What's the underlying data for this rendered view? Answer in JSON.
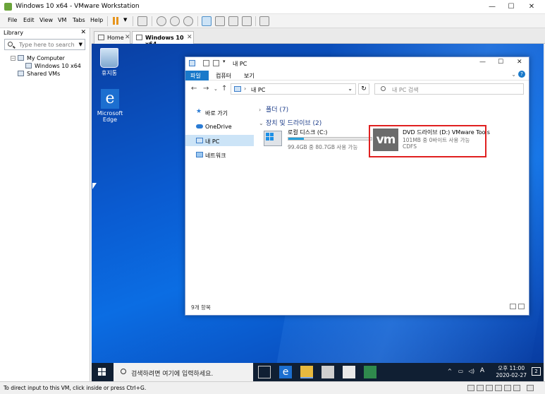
{
  "window": {
    "title": "Windows 10 x64 - VMware Workstation"
  },
  "menu": [
    "File",
    "Edit",
    "View",
    "VM",
    "Tabs",
    "Help"
  ],
  "library": {
    "title": "Library",
    "search_placeholder": "Type here to search",
    "tree": [
      "My Computer",
      "Windows 10 x64",
      "Shared VMs"
    ]
  },
  "tabs": [
    {
      "label": "Home"
    },
    {
      "label": "Windows 10 x64"
    }
  ],
  "desktop": {
    "icons": [
      "휴지통",
      "Microsoft Edge"
    ]
  },
  "explorer": {
    "title": "내 PC",
    "ribbon_tabs": [
      "파일",
      "컴퓨터",
      "보기"
    ],
    "address": "내 PC",
    "search_placeholder": "내 PC 검색",
    "nav": [
      "바로 가기",
      "OneDrive",
      "내 PC",
      "네트워크"
    ],
    "groups": {
      "folders": "폴더 (7)",
      "devices": "장치 및 드라이브 (2)"
    },
    "drives": [
      {
        "name": "로컬 디스크 (C:)",
        "detail": "99.4GB 중 80.7GB 사용 가능",
        "used_fraction": 0.19
      },
      {
        "name": "DVD 드라이브 (D:) VMware Tools",
        "detail": "101MB 중 0바이트 사용 가능",
        "fs": "CDFS",
        "logo": "vm"
      }
    ],
    "status": "9개 항목",
    "highlight_color": "#e02020"
  },
  "taskbar": {
    "search_text": "검색하려면 여기에 입력하세요.",
    "ime": "A",
    "time": "오후 11:00",
    "date": "2020-02-27",
    "notifications": "2"
  },
  "statusbar": {
    "text": "To direct input to this VM, click inside or press Ctrl+G."
  }
}
